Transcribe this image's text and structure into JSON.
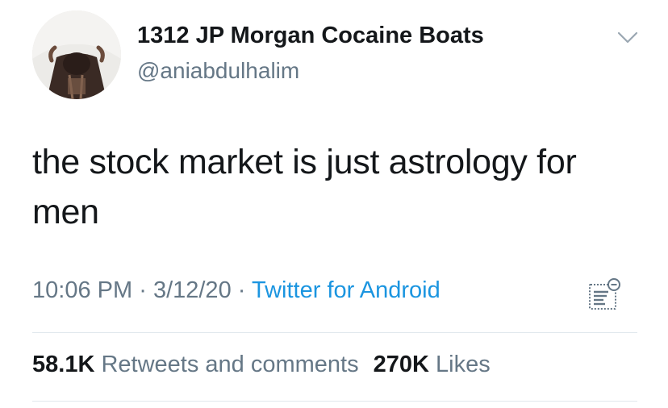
{
  "tweet": {
    "author": {
      "display_name": "1312 JP Morgan Cocaine Boats",
      "handle": "@aniabdulhalim"
    },
    "text": "the stock market is just astrology for men",
    "time": "10:06 PM",
    "separator": "·",
    "date": "3/12/20",
    "source": "Twitter for Android",
    "stats": {
      "retweets_count": "58.1K",
      "retweets_label": "Retweets and comments",
      "likes_count": "270K",
      "likes_label": "Likes"
    },
    "icons": {
      "avatar": "profile-photo",
      "menu": "chevron-down-icon",
      "analytics": "analytics-icon"
    },
    "colors": {
      "text": "#14171a",
      "secondary": "#657786",
      "link": "#1b95e0",
      "divider": "#e1e8ed"
    }
  }
}
